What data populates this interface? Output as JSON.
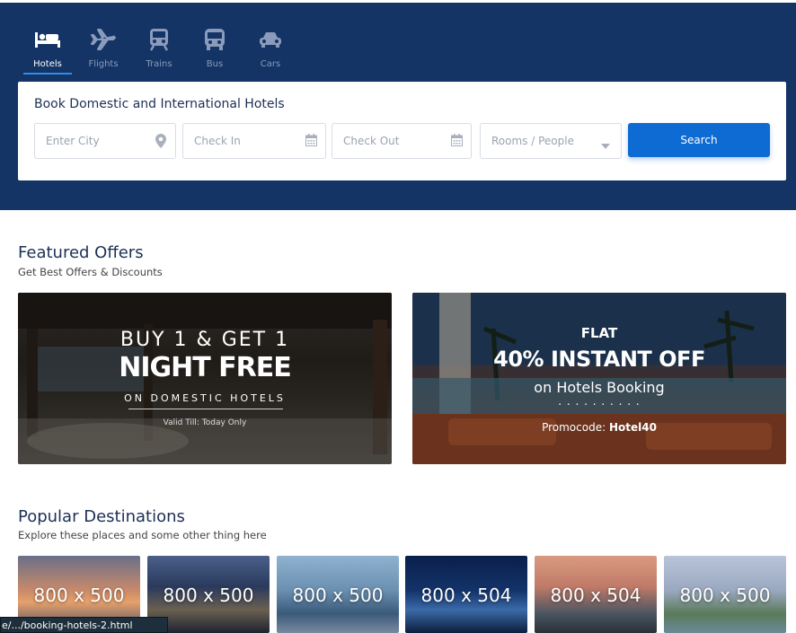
{
  "nav_tabs": [
    {
      "label": "Hotels",
      "icon": "bed-icon",
      "active": true
    },
    {
      "label": "Flights",
      "icon": "plane-icon",
      "active": false
    },
    {
      "label": "Trains",
      "icon": "train-icon",
      "active": false
    },
    {
      "label": "Bus",
      "icon": "bus-icon",
      "active": false
    },
    {
      "label": "Cars",
      "icon": "car-icon",
      "active": false
    }
  ],
  "booking": {
    "title": "Book Domestic and International Hotels",
    "city_placeholder": "Enter City",
    "checkin_placeholder": "Check In",
    "checkout_placeholder": "Check Out",
    "rooms_placeholder": "Rooms / People",
    "search_label": "Search"
  },
  "featured": {
    "title": "Featured Offers",
    "subtitle": "Get Best Offers & Discounts",
    "offer1": {
      "line1": "BUY 1 & GET 1",
      "line2": "NIGHT FREE",
      "line3": "ON DOMESTIC HOTELS",
      "line4": "Valid Till: Today Only"
    },
    "offer2": {
      "line1": "FLAT",
      "line2": "40% INSTANT OFF",
      "line3": "on Hotels Booking",
      "dots": ". . . . . . . . . .",
      "promo_label": "Promocode:",
      "promo_code": "Hotel40"
    }
  },
  "popular": {
    "title": "Popular Destinations",
    "subtitle": "Explore these places and some other thing here",
    "items": [
      "800 x 500",
      "800 x 500",
      "800 x 500",
      "800 x 504",
      "800 x 504",
      "800 x 500"
    ]
  },
  "statusbar": "e/.../booking-hotels-2.html",
  "colors": {
    "hero_bg": "#133464",
    "accent": "#0e6bd3",
    "tab_underline": "#2d8cf0"
  }
}
